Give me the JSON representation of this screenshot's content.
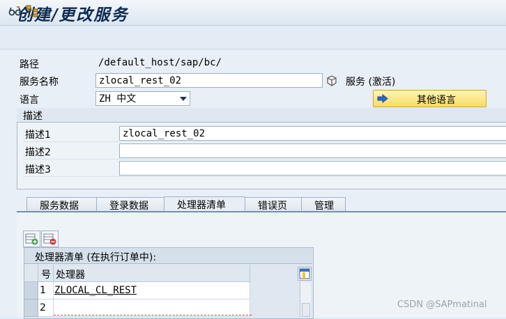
{
  "window": {
    "title": "创建/更改服务"
  },
  "toolbar": {
    "icons": [
      "glasses-icon",
      "hierarchy-icon"
    ]
  },
  "form": {
    "path_label": "路径",
    "path_value": "/default_host/sap/bc/",
    "service_name_label": "服务名称",
    "service_name_value": "zlocal_rest_02",
    "service_status": "服务 (激活)",
    "language_label": "语言",
    "language_value": "ZH 中文",
    "other_language_button": "其他语言"
  },
  "description": {
    "group_title": "描述",
    "rows": [
      {
        "label": "描述1",
        "value": "zlocal_rest_02"
      },
      {
        "label": "描述2",
        "value": ""
      },
      {
        "label": "描述3",
        "value": ""
      }
    ]
  },
  "tabs": [
    {
      "label": "服务数据",
      "active": false
    },
    {
      "label": "登录数据",
      "active": false
    },
    {
      "label": "处理器清单",
      "active": true
    },
    {
      "label": "错误页",
      "active": false
    },
    {
      "label": "管理",
      "active": false
    }
  ],
  "handler_table": {
    "title": "处理器清单 (在执行订单中):",
    "col_no": "号",
    "col_handler": "处理器",
    "rows": [
      {
        "no": "1",
        "handler": "ZLOCAL_CL_REST"
      },
      {
        "no": "2",
        "handler": ""
      }
    ]
  },
  "watermark": "CSDN @SAPmatinal"
}
